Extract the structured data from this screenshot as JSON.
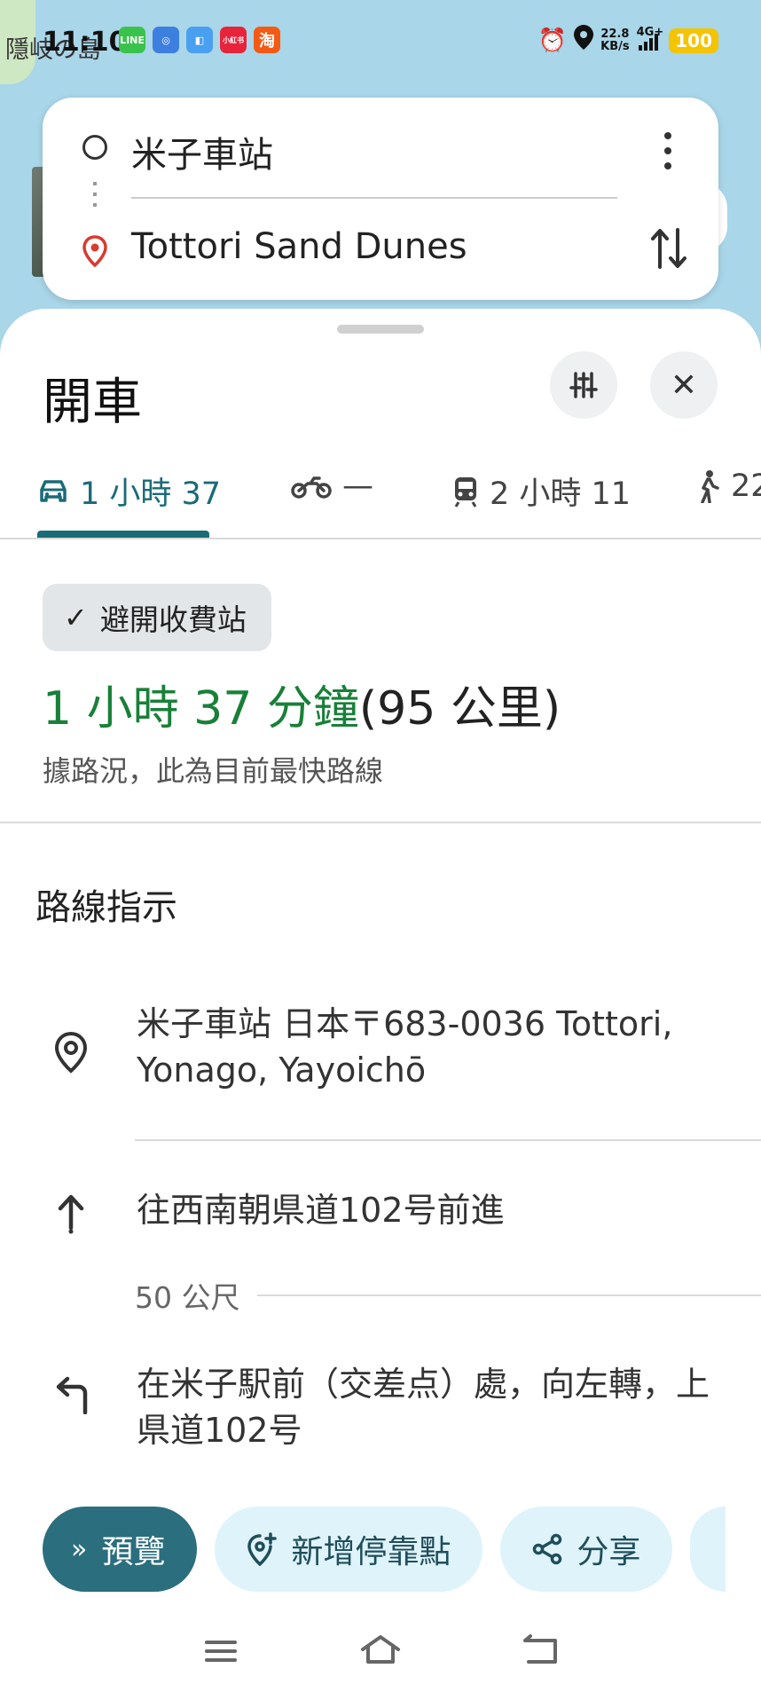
{
  "map": {
    "label": "隱岐の島"
  },
  "status_bar": {
    "time": "11:10",
    "apps": [
      {
        "name": "line-app-icon",
        "glyph": "LINE",
        "color": "#3ac34c"
      },
      {
        "name": "browser-app-icon",
        "glyph": "◎",
        "color": "#3d7fe0"
      },
      {
        "name": "files-app-icon",
        "glyph": "◧",
        "color": "#4aa0f0"
      },
      {
        "name": "xiaohongshu-app-icon",
        "glyph": "小紅书",
        "color": "#e8243c"
      },
      {
        "name": "taobao-app-icon",
        "glyph": "淘",
        "color": "#f45a14"
      }
    ],
    "net_speed_value": "22.8",
    "net_speed_unit": "KB/s",
    "net_type": "4G+",
    "battery": "100"
  },
  "search": {
    "origin": "米子車站",
    "destination": "Tottori Sand Dunes"
  },
  "sheet": {
    "title": "開車",
    "tabs": [
      {
        "label": "1 小時 37",
        "icon": "car-icon"
      },
      {
        "label": "—",
        "icon": "motorcycle-icon"
      },
      {
        "label": "2 小時 11",
        "icon": "train-icon"
      },
      {
        "label": "22",
        "icon": "walk-icon"
      }
    ],
    "avoid_chip": "避開收費站",
    "route_duration": "1 小時 37 分鐘",
    "route_distance": "(95 公里)",
    "route_note": "據路況，此為目前最快路線",
    "section_title": "路線指示",
    "steps": [
      {
        "text": "米子車站 日本〒683-0036 Tottori, Yonago, Yayoichō"
      },
      {
        "text": "往西南朝県道102号前進",
        "distance": "50 公尺"
      },
      {
        "text": "在米子駅前（交差点）處，向左轉，上県道102号"
      }
    ],
    "actions": {
      "preview": "預覽",
      "add_stop": "新增停靠點",
      "share": "分享"
    }
  },
  "accent_color": "#1a6b78",
  "route_color": "#188038"
}
